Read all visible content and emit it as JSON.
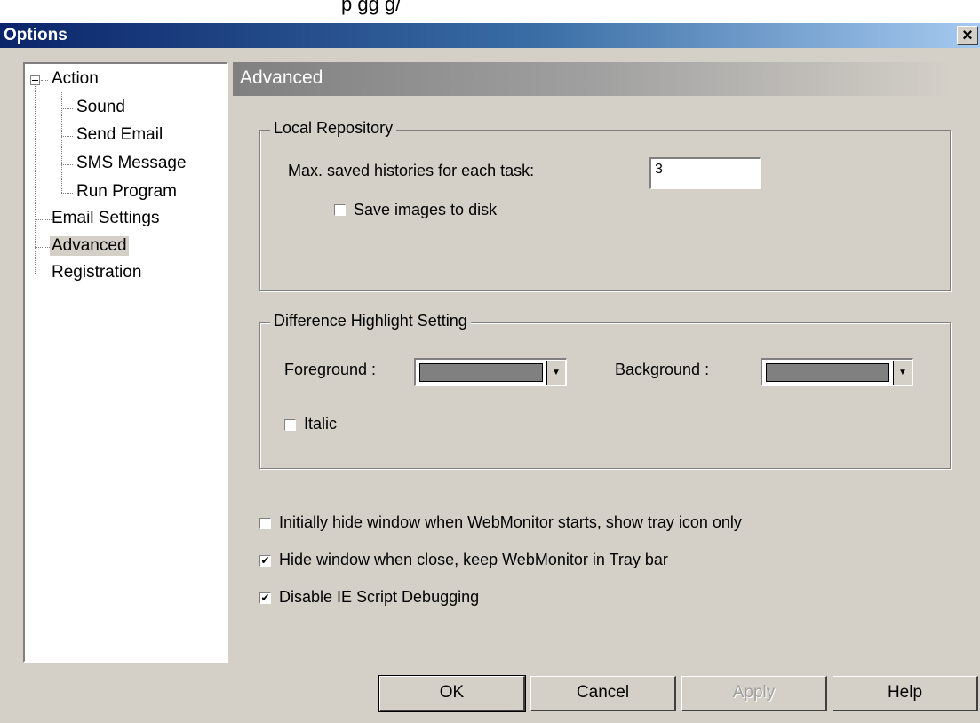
{
  "top_cutoff_text": "p    gg g/",
  "window": {
    "title": "Options",
    "close_symbol": "×"
  },
  "tree": {
    "collapse_symbol": "⊟",
    "items": [
      {
        "label": "Action"
      },
      {
        "label": "Sound"
      },
      {
        "label": "Send Email"
      },
      {
        "label": "SMS Message"
      },
      {
        "label": "Run Program"
      },
      {
        "label": "Email Settings"
      },
      {
        "label": "Advanced",
        "selected": true
      },
      {
        "label": "Registration"
      }
    ]
  },
  "panel": {
    "title": "Advanced"
  },
  "local_repository": {
    "legend": "Local Repository",
    "max_histories_label": "Max. saved histories for each task:",
    "max_histories_value": "3",
    "save_images_label": "Save images to disk",
    "save_images_checked": false
  },
  "highlight": {
    "legend": "Difference Highlight Setting",
    "foreground_label": "Foreground :",
    "background_label": "Background :",
    "foreground_color": "#808080",
    "background_color": "#808080",
    "italic_label": "Italic",
    "italic_checked": false
  },
  "options": [
    {
      "label": "Initially hide window when WebMonitor starts, show tray icon only",
      "checked": false
    },
    {
      "label": "Hide window when close, keep WebMonitor in Tray bar",
      "checked": true
    },
    {
      "label": "Disable IE Script Debugging",
      "checked": true
    }
  ],
  "check_mark": "✔",
  "buttons": {
    "ok": "OK",
    "cancel": "Cancel",
    "apply": "Apply",
    "help": "Help"
  }
}
